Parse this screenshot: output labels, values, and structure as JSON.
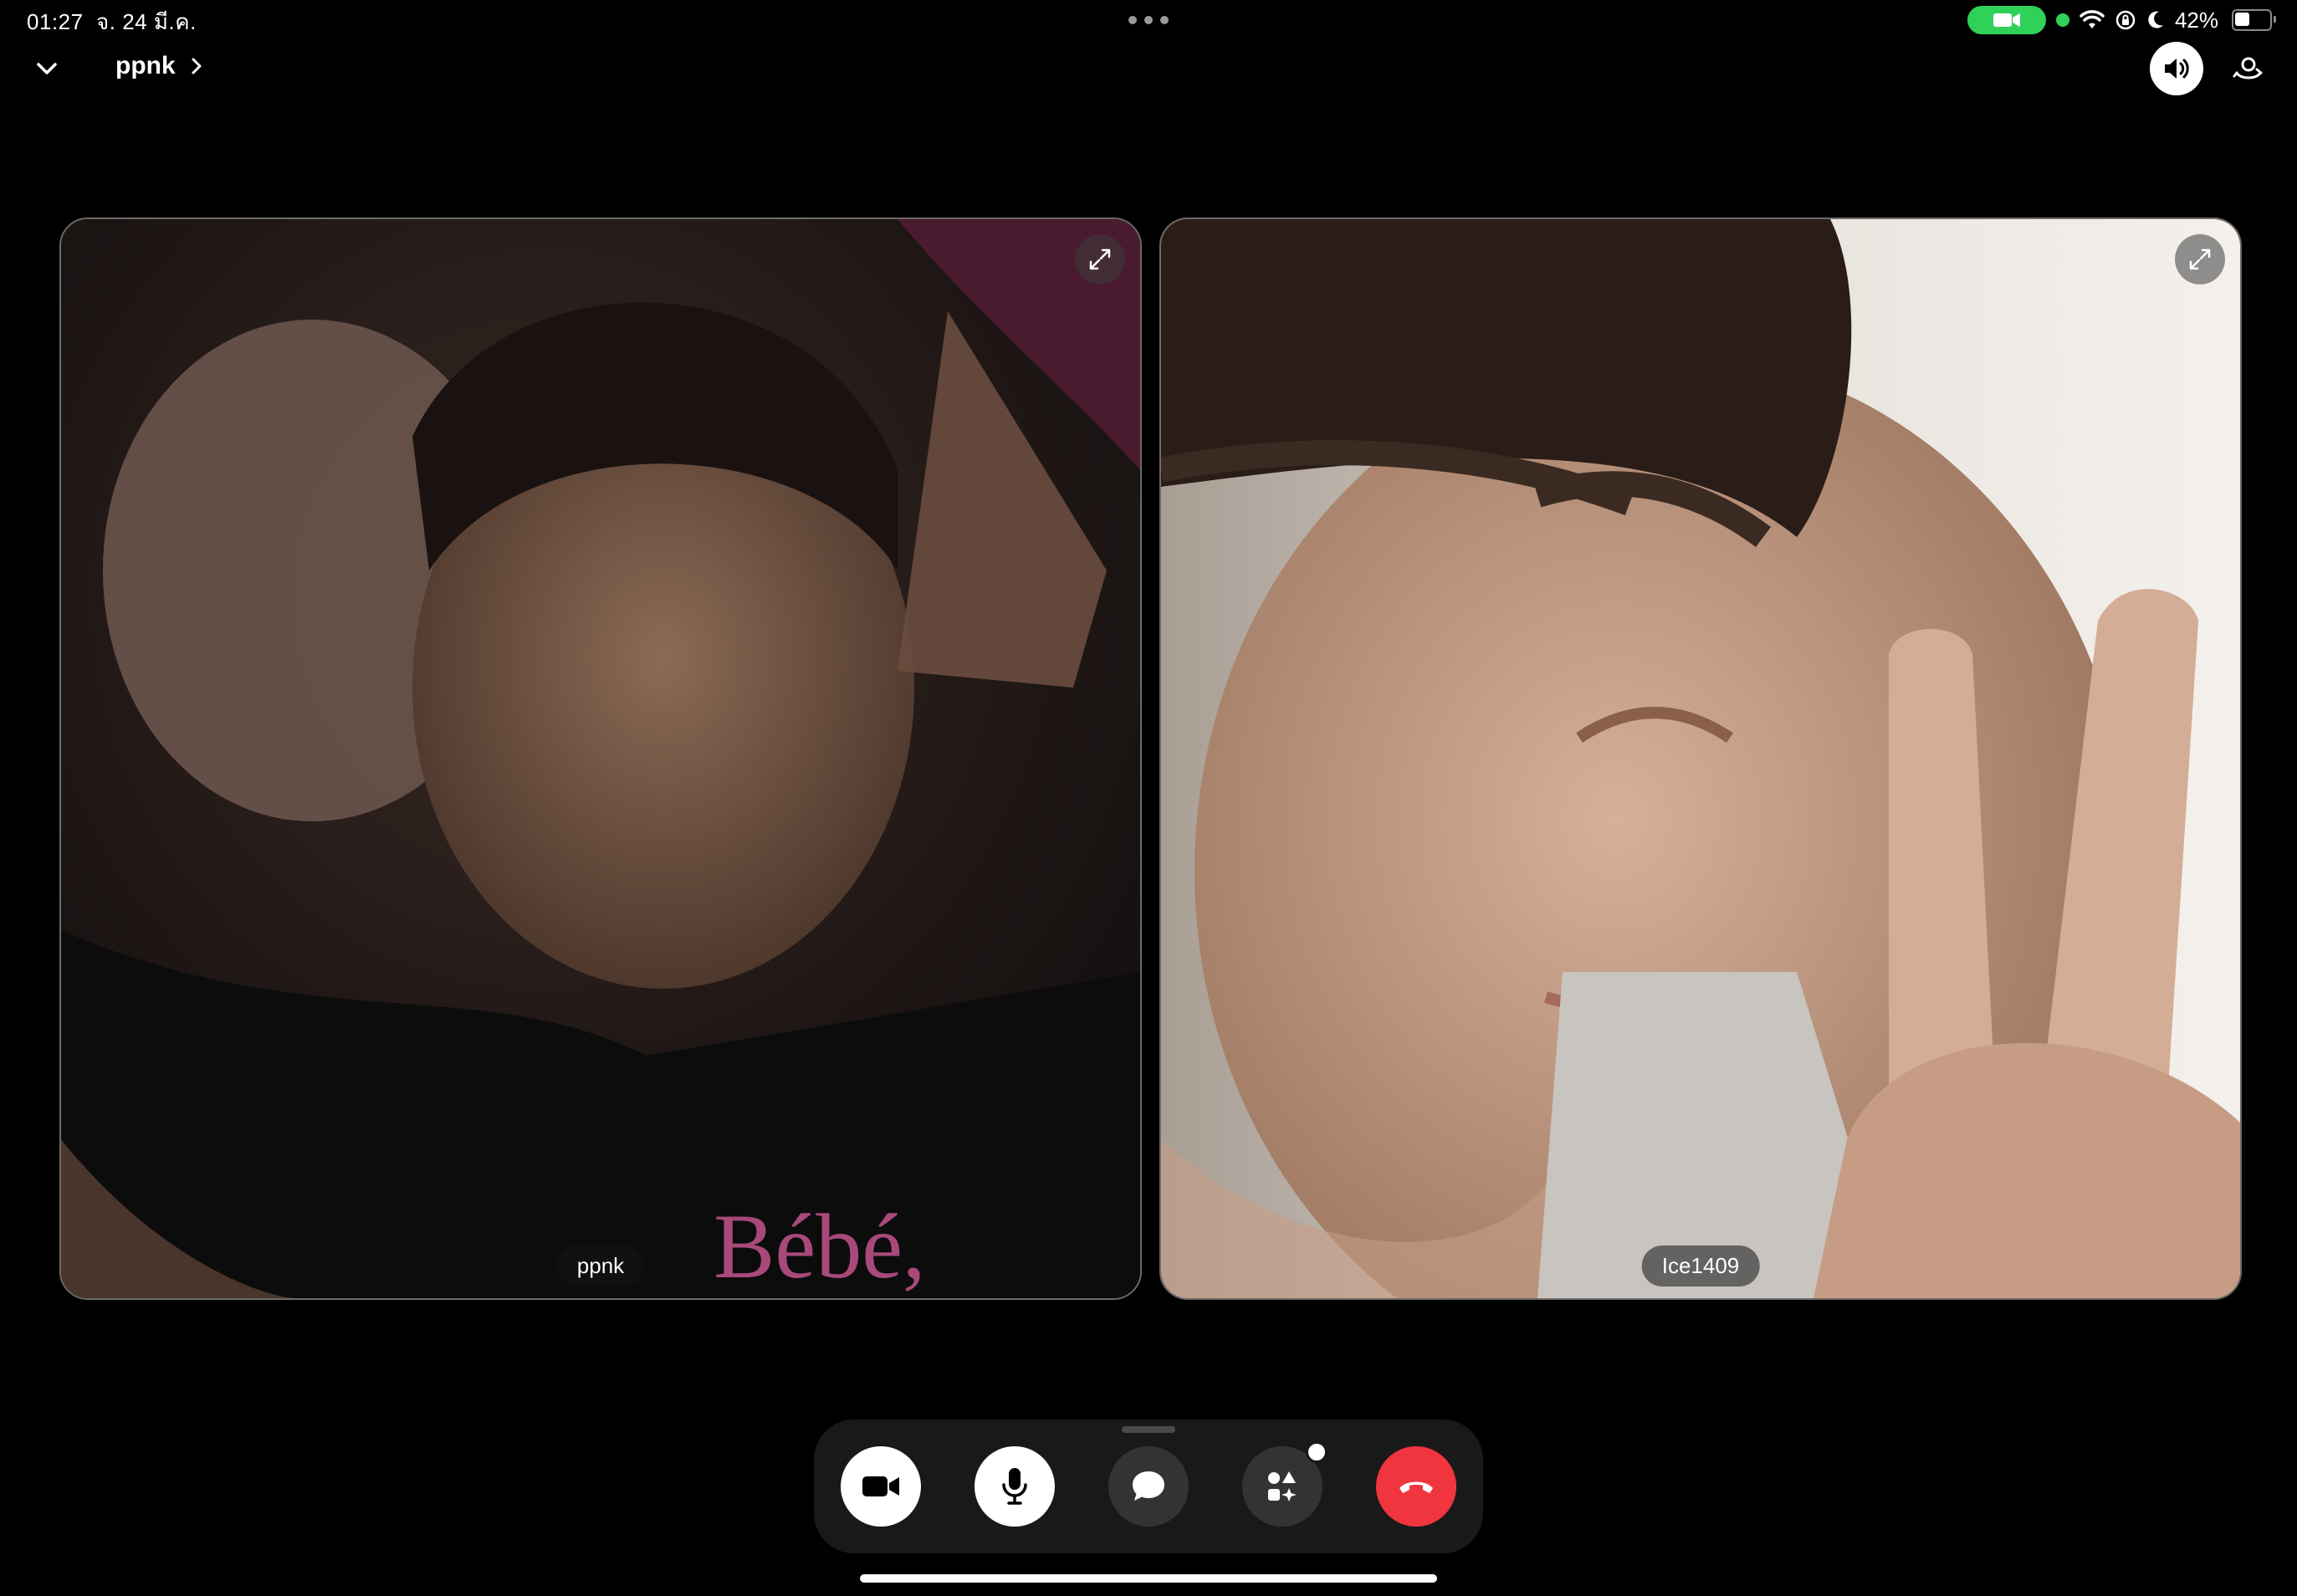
{
  "status_bar": {
    "time": "01:27",
    "date": "จ. 24 มี.ค.",
    "battery_percent": "42%",
    "battery_level": 0.42,
    "icons": [
      "video-camera-icon",
      "green-dot-indicator",
      "wifi-icon",
      "orientation-lock-icon",
      "moon-icon",
      "battery-icon"
    ]
  },
  "call": {
    "title": "ppnk",
    "collapse_icon": "chevron-down-icon",
    "title_chevron": "chevron-right-icon",
    "speaker_icon": "speaker-icon",
    "flip_icon": "camera-flip-icon"
  },
  "participants": [
    {
      "name": "ppnk",
      "expand_icon": "expand-icon"
    },
    {
      "name": "Ice1409",
      "expand_icon": "expand-icon"
    }
  ],
  "controls": [
    {
      "name": "camera",
      "icon": "video-camera-icon",
      "style": "white"
    },
    {
      "name": "microphone",
      "icon": "microphone-icon",
      "style": "white"
    },
    {
      "name": "chat",
      "icon": "chat-bubble-icon",
      "style": "dark"
    },
    {
      "name": "effects",
      "icon": "effects-icon",
      "style": "dark",
      "has_badge": true
    },
    {
      "name": "end-call",
      "icon": "hang-up-icon",
      "style": "red"
    }
  ],
  "colors": {
    "background": "#000000",
    "control_bar": "#191919",
    "end_call": "#f0353f",
    "status_green": "#2fd158"
  }
}
